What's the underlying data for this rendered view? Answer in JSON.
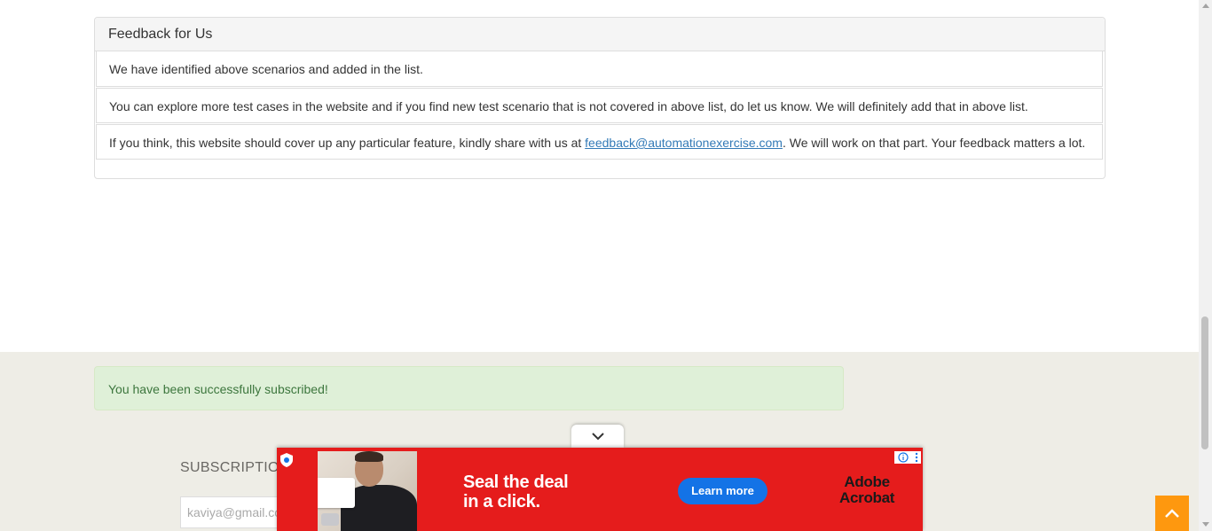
{
  "feedback": {
    "heading": "Feedback for Us",
    "items": [
      "We have identified above scenarios and added in the list.",
      "You can explore more test cases in the website and if you find new test scenario that is not covered in above list, do let us know. We will definitely add that in above list."
    ],
    "item3_prefix": "If you think, this website should cover up any particular feature, kindly share with us at ",
    "item3_link": "feedback@automationexercise.com",
    "item3_suffix": ". We will work on that part. Your feedback matters a lot."
  },
  "footer": {
    "success_message": "You have been successfully subscribed!",
    "subscription_title": "SUBSCRIPTION",
    "email_value": "kaviya@gmail.com"
  },
  "ad": {
    "headline_line1": "Seal the deal",
    "headline_line2": "in a click.",
    "cta_label": "Learn more",
    "brand_line1": "Adobe",
    "brand_line2": "Acrobat",
    "background_color": "#e51c1c",
    "cta_color": "#1473e6",
    "icons": [
      "shield-icon",
      "info-icon",
      "more-options-icon",
      "chevron-down-icon"
    ]
  },
  "colors": {
    "accent": "#fe980f",
    "success_bg": "#dff0d8",
    "success_text": "#3c763d",
    "link": "#337ab7",
    "footer_bg": "#eeede6"
  }
}
